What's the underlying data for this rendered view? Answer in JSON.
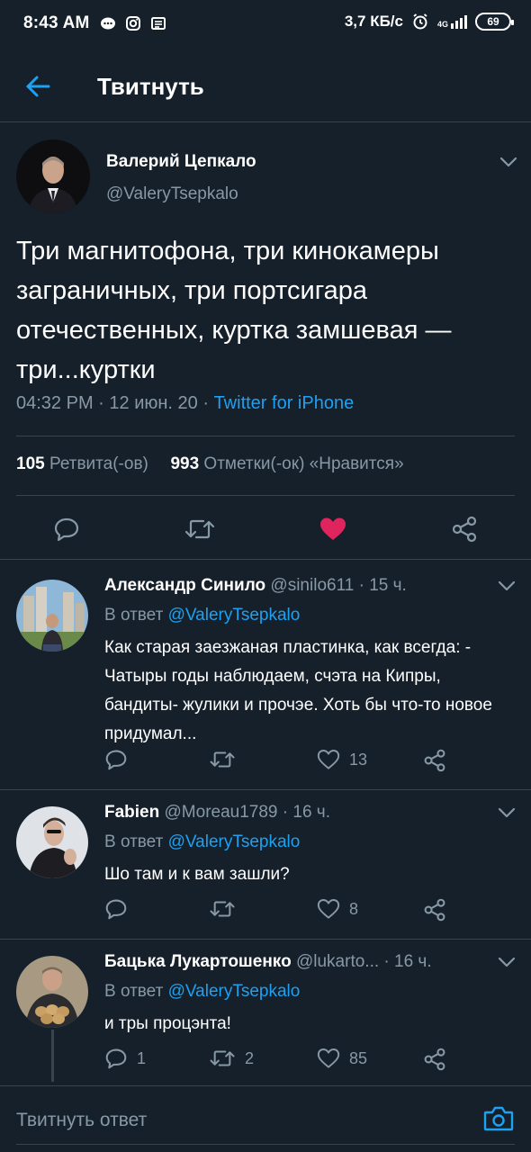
{
  "status_bar": {
    "time": "8:43 AM",
    "network_speed": "3,7 КБ/с",
    "network_type": "4G",
    "battery": "69"
  },
  "header": {
    "title": "Твитнуть"
  },
  "tweet": {
    "author_name": "Валерий Цепкало",
    "author_handle": "@ValeryTsepkalo",
    "text": "Три магнитофона, три кинокамеры заграничных, три портсигара отечественных, куртка замшевая — три...куртки",
    "time": "04:32 PM",
    "date": "12 июн. 20",
    "source": "Twitter for iPhone",
    "retweets_count": "105",
    "retweets_label": "Ретвита(-ов)",
    "likes_count": "993",
    "likes_label": "Отметки(-ок) «Нравится»",
    "liked": true
  },
  "replies": [
    {
      "name": "Александр Синило",
      "handle": "@sinilo611",
      "time": "15 ч.",
      "reply_to_label": "В ответ",
      "reply_to": "@ValeryTsepkalo",
      "text": "Как старая заезжаная пластинка, как всегда:  - Чатыры годы наблюдаем, счэта на Кипры, бандиты- жулики и прочэе. Хоть бы что-то новое придумал...",
      "reply_count": "",
      "retweet_count": "",
      "like_count": "13"
    },
    {
      "name": "Fabien",
      "handle": "@Moreau1789",
      "time": "16 ч.",
      "reply_to_label": "В ответ",
      "reply_to": "@ValeryTsepkalo",
      "text": "Шо там и к вам зашли?",
      "reply_count": "",
      "retweet_count": "",
      "like_count": "8"
    },
    {
      "name": "Бацька Лукартошенко",
      "handle": "@lukarto...",
      "time": "16 ч.",
      "reply_to_label": "В ответ",
      "reply_to": "@ValeryTsepkalo",
      "text": "и тры процэнта!",
      "reply_count": "1",
      "retweet_count": "2",
      "like_count": "85"
    }
  ],
  "compose": {
    "placeholder": "Твитнуть ответ"
  },
  "colors": {
    "background": "#15202b",
    "accent": "#1da1f2",
    "like": "#e0245e",
    "muted": "#8899a6",
    "divider": "#38444d"
  },
  "icons": {
    "back": "arrow-left-icon",
    "caret": "chevron-down-icon",
    "reply": "comment-bubble-icon",
    "retweet": "retweet-icon",
    "like": "heart-icon",
    "share": "share-icon",
    "camera": "camera-icon"
  }
}
